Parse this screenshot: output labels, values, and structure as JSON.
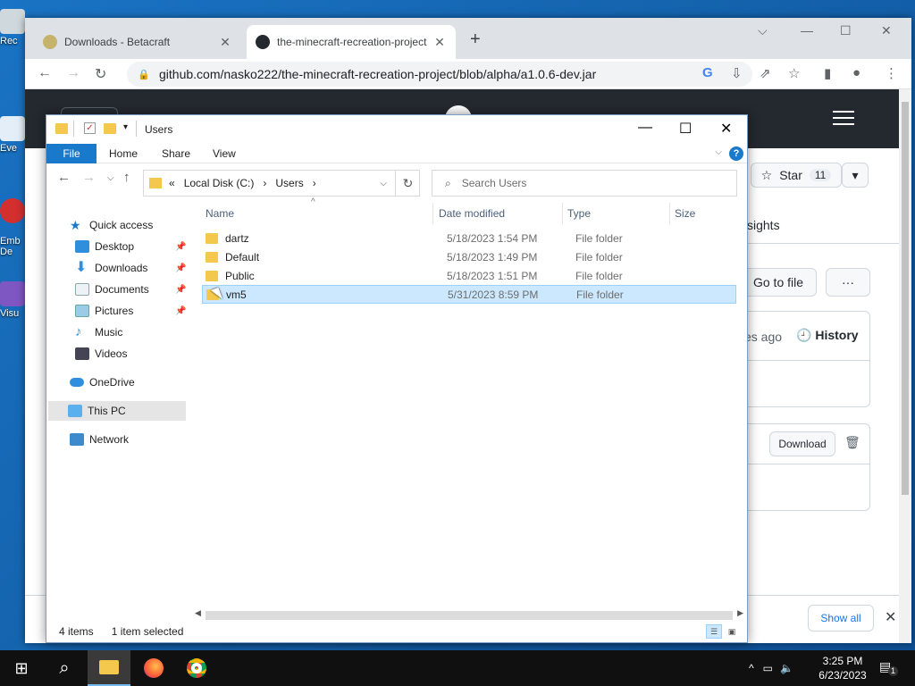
{
  "desktop": {
    "icons": [
      {
        "label": "Rec"
      },
      {
        "label": "Eve"
      },
      {
        "label": "Emb\nDe"
      },
      {
        "label": "Visu"
      }
    ]
  },
  "chrome": {
    "tabs": [
      {
        "title": "Downloads - Betacraft",
        "close": "✕"
      },
      {
        "title": "the-minecraft-recreation-project",
        "close": "✕"
      }
    ],
    "new_tab": "+",
    "url": "github.com/nasko222/the-minecraft-recreation-project/blob/alpha/a1.0.6-dev.jar"
  },
  "github": {
    "star_label": "Star",
    "star_count": "11",
    "insights_label": "sights",
    "go_to_file": "Go to file",
    "more": "···",
    "time_ago": "es ago",
    "history": "History",
    "download": "Download",
    "show_all": "Show all"
  },
  "explorer": {
    "title": "Users",
    "ribbon_tabs": [
      "File",
      "Home",
      "Share",
      "View"
    ],
    "help": "?",
    "breadcrumbs": [
      "«",
      "Local Disk (C:)",
      "›",
      "Users",
      "›"
    ],
    "search_placeholder": "Search Users",
    "nav": {
      "quick_access": "Quick access",
      "items": [
        {
          "label": "Desktop",
          "pinned": true
        },
        {
          "label": "Downloads",
          "pinned": true
        },
        {
          "label": "Documents",
          "pinned": true
        },
        {
          "label": "Pictures",
          "pinned": true
        },
        {
          "label": "Music",
          "pinned": false
        },
        {
          "label": "Videos",
          "pinned": false
        }
      ],
      "onedrive": "OneDrive",
      "this_pc": "This PC",
      "network": "Network"
    },
    "columns": [
      "Name",
      "Date modified",
      "Type",
      "Size"
    ],
    "rows": [
      {
        "name": "dartz",
        "date": "5/18/2023 1:54 PM",
        "type": "File folder",
        "selected": false
      },
      {
        "name": "Default",
        "date": "5/18/2023 1:49 PM",
        "type": "File folder",
        "selected": false
      },
      {
        "name": "Public",
        "date": "5/18/2023 1:51 PM",
        "type": "File folder",
        "selected": false
      },
      {
        "name": "vm5",
        "date": "5/31/2023 8:59 PM",
        "type": "File folder",
        "selected": true
      }
    ],
    "status": {
      "count": "4 items",
      "selection": "1 item selected"
    }
  },
  "taskbar": {
    "time": "3:25 PM",
    "date": "6/23/2023",
    "notification_count": "1"
  },
  "colors": {
    "file_tab": "#1979ca",
    "selection": "#cce8ff",
    "folder": "#f4c84c",
    "github_header": "#24292f",
    "taskbar": "#101010"
  }
}
